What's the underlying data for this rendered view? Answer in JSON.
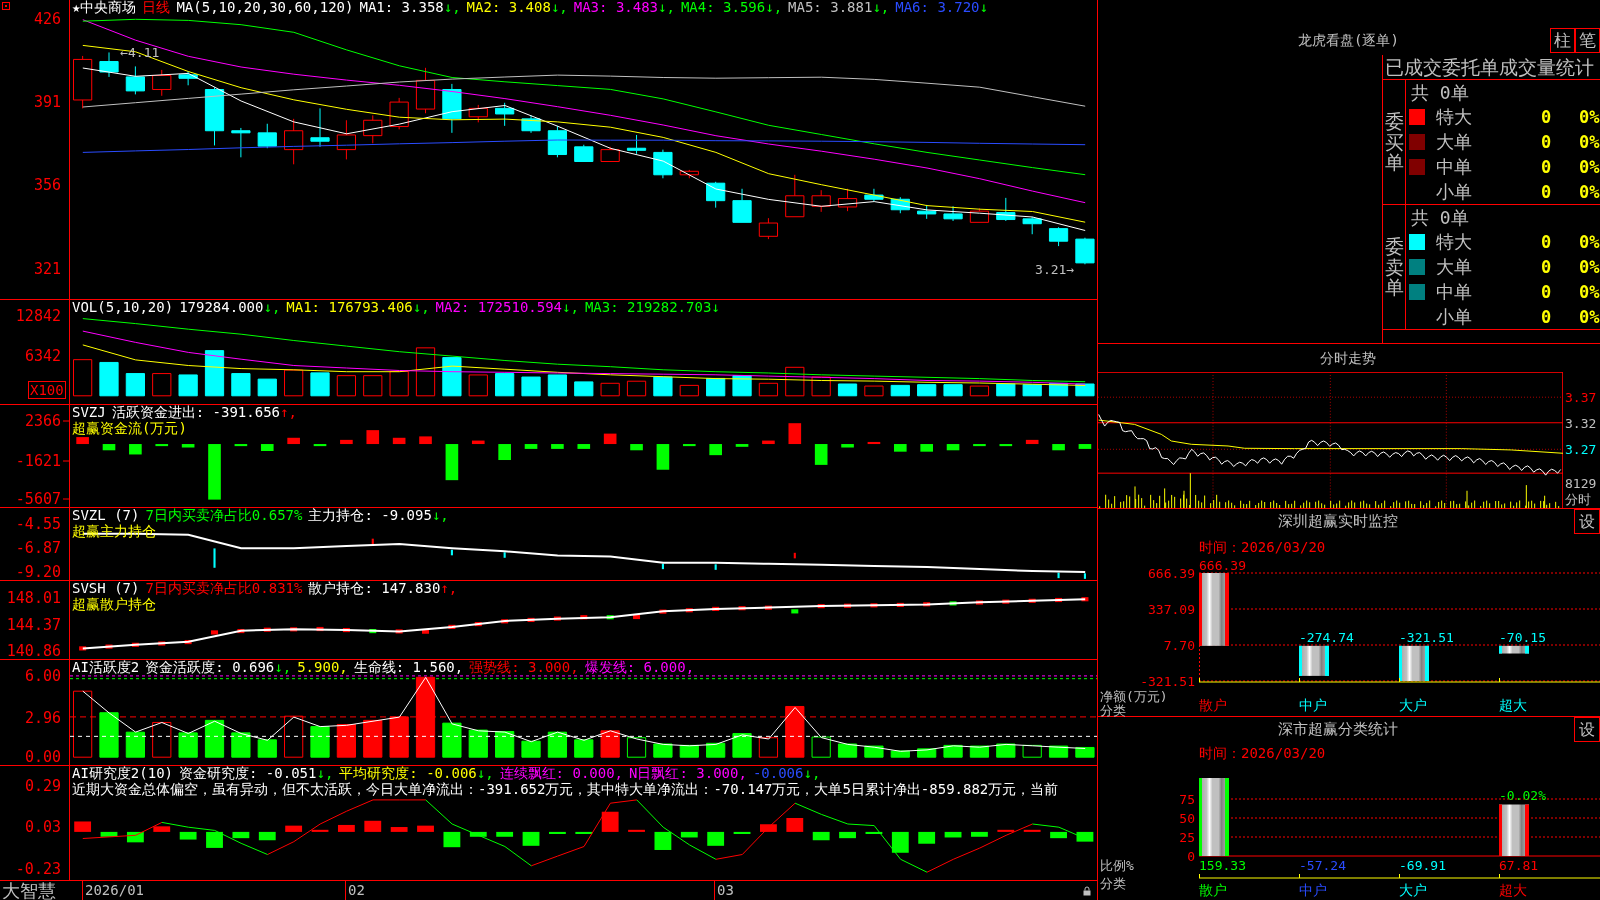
{
  "kline": {
    "header": [
      {
        "text": "★中央商场",
        "color": "#ffffff"
      },
      {
        "text": "日线",
        "color": "#ff0000"
      },
      {
        "text": "MA(5,10,20,30,60,120)",
        "color": "#ffffff"
      },
      {
        "text": "MA1: 3.358",
        "arrow": "↓,",
        "rising": false,
        "color": "#ffffff"
      },
      {
        "text": "MA2: 3.408",
        "arrow": "↓,",
        "rising": false,
        "color": "#ffff00"
      },
      {
        "text": "MA3: 3.483",
        "arrow": "↓,",
        "rising": false,
        "color": "#ff00ff"
      },
      {
        "text": "MA4: 3.596",
        "arrow": "↓,",
        "rising": false,
        "color": "#00ff00"
      },
      {
        "text": "MA5: 3.881",
        "arrow": "↓,",
        "rising": false,
        "color": "#c0c0c0"
      },
      {
        "text": "MA6: 3.720",
        "arrow": "↓",
        "rising": false,
        "color": "#2a4cff"
      }
    ],
    "chart_data": {
      "type": "line",
      "categories": [
        null,
        null,
        null,
        null,
        null,
        null,
        null,
        null,
        null,
        null,
        null,
        null,
        null,
        null,
        null,
        null,
        null,
        null,
        null,
        null
      ],
      "ylim": [
        308.2,
        434
      ],
      "yticks": [
        426,
        391,
        356,
        321
      ],
      "series": [
        {
          "color": "#ffffff",
          "values": [
            405.4,
            401.9,
            403.1,
            391.5,
            382.7,
            377.7,
            381.8,
            387.0,
            389.6,
            380.9,
            371.6,
            366.2,
            354.5,
            350.1,
            347.2,
            349.2,
            345.7,
            344.3,
            342.7,
            337.0
          ]
        },
        {
          "color": "#ffff00",
          "values": [
            414.9,
            412.2,
            403.9,
            397.1,
            392.0,
            388.0,
            384.7,
            383.6,
            383.9,
            382.7,
            380.5,
            376.2,
            369.9,
            360.9,
            356.3,
            351.9,
            347.5,
            346.0,
            345.0,
            340.5
          ]
        },
        {
          "color": "#ff00ff",
          "values": [
            425.7,
            417.1,
            410.3,
            405.8,
            402.8,
            400.3,
            398.1,
            395.5,
            392.5,
            389.1,
            385.5,
            381.4,
            376.9,
            373.4,
            370.4,
            367.0,
            363.3,
            358.8,
            353.6,
            348.7
          ]
        },
        {
          "color": "#00ff00",
          "values": [
            425.1,
            425.9,
            425.4,
            423.6,
            420.4,
            413.0,
            406.3,
            401.4,
            399.6,
            398.0,
            396.4,
            392.4,
            386.9,
            381.3,
            377.4,
            373.5,
            369.9,
            366.7,
            363.5,
            360.5
          ]
        },
        {
          "color": "#c0c0c0",
          "values": [
            389.0,
            390.8,
            392.6,
            394.4,
            396.2,
            397.8,
            399.5,
            400.7,
            401.6,
            402.4,
            402.0,
            401.4,
            401.1,
            401.3,
            401.5,
            400.6,
            399.0,
            397.3,
            393.3,
            389.3
          ]
        },
        {
          "color": "#2a4cff",
          "values": [
            369.9,
            370.5,
            371.1,
            371.8,
            372.4,
            372.9,
            373.5,
            374.0,
            374.6,
            375.1,
            375.0,
            375.0,
            374.8,
            374.7,
            374.6,
            374.4,
            374.1,
            373.7,
            373.4,
            373.1
          ]
        }
      ],
      "annotations": [
        "←4.11",
        "3.21→"
      ]
    }
  },
  "indicators": [
    {
      "kind": "volume",
      "header": [
        {
          "text": "VOL(5,10,20)",
          "color": "#ffffff"
        },
        {
          "text": "179284.000",
          "arrow": "↓,",
          "rising": false,
          "color": "#ffffff"
        },
        {
          "text": "MA1: 176793.406",
          "arrow": "↓,",
          "rising": false,
          "color": "#ffff00"
        },
        {
          "text": "MA2: 172510.594",
          "arrow": "↓,",
          "rising": false,
          "color": "#ff00ff"
        },
        {
          "text": "MA3: 219282.703",
          "arrow": "↓",
          "rising": false,
          "color": "#00ff00"
        }
      ],
      "chart_data": {
        "type": "line",
        "categories": [
          null,
          null,
          null,
          null,
          null,
          null,
          null,
          null,
          null,
          null,
          null,
          null,
          null,
          null,
          null,
          null,
          null,
          null,
          null,
          null
        ],
        "ylim": [
          -1265,
          15378
        ],
        "yticks": [
          12842,
          6342
        ],
        "series": [
          {
            "color": "#ffff00",
            "values": [
              8200,
              5800,
              4900,
              4400,
              4200,
              3900,
              3900,
              4800,
              4300,
              3800,
              3400,
              3100,
              2800,
              2700,
              2500,
              2400,
              2200,
              2100,
              1900,
              1700
            ]
          },
          {
            "color": "#ff00ff",
            "values": [
              10400,
              8600,
              7000,
              5900,
              4900,
              4500,
              4100,
              3900,
              3800,
              3700,
              3600,
              3500,
              3400,
              3200,
              3000,
              2800,
              2500,
              2400,
              2200,
              1900
            ]
          },
          {
            "color": "#00ff00",
            "values": [
              12400,
              11600,
              10700,
              9900,
              8900,
              8000,
              7100,
              6400,
              5700,
              5100,
              4700,
              4200,
              3900,
              3700,
              3400,
              3200,
              3000,
              2800,
              2500,
              2300
            ]
          }
        ]
      },
      "unit": "X100"
    },
    {
      "kind": "flow",
      "header": [
        {
          "text": "SVZJ",
          "color": "#ffffff"
        },
        {
          "text": "活跃资金进出: -391.656",
          "arrow": "↑,",
          "rising": true,
          "color": "#ffffff"
        }
      ],
      "subtitle": "超赢资金流(万元)",
      "axis_labels": [
        "2366",
        "-1621",
        "-5607"
      ]
    },
    {
      "kind": "main_holding",
      "header": [
        {
          "text": "SVZL (7)",
          "color": "#ffffff"
        },
        {
          "text": "7日内买卖净占比0.657%",
          "color": "#00ff00"
        },
        {
          "text": "主力持仓: -9.095",
          "arrow": "↓,",
          "rising": false,
          "color": "#ffffff"
        }
      ],
      "subtitle": "超赢主力持仓",
      "chart_data": {
        "type": "line",
        "categories": [
          null,
          null,
          null,
          null,
          null,
          null,
          null,
          null,
          null,
          null,
          null,
          null,
          null,
          null,
          null,
          null,
          null,
          null,
          null,
          null
        ],
        "ylim": [
          -9.959,
          -3.032
        ],
        "yticks": [
          {
            "value": -4.55,
            "label": "-4.55"
          },
          {
            "value": -6.87,
            "label": "-6.87"
          },
          {
            "value": -9.2,
            "label": "-9.20"
          }
        ],
        "series": [
          {
            "color": "#ffffff",
            "values": [
              -5.5,
              -5.5,
              -5.6,
              -6.9,
              -6.9,
              -6.7,
              -6.5,
              -6.9,
              -7.2,
              -7.6,
              -7.7,
              -8.3,
              -8.3,
              -8.4,
              -8.5,
              -8.6,
              -8.7,
              -8.9,
              -9.1,
              -9.2
            ]
          }
        ]
      }
    },
    {
      "kind": "retail_holding",
      "header": [
        {
          "text": "SVSH (7)",
          "color": "#ffffff"
        },
        {
          "text": "7日内买卖净占比0.831%",
          "color": "#ff0000"
        },
        {
          "text": "散户持仓: 147.830",
          "arrow": "↑,",
          "rising": true,
          "color": "#ffffff"
        }
      ],
      "subtitle": "超赢散户持仓",
      "chart_data": {
        "type": "line",
        "categories": [
          null,
          null,
          null,
          null,
          null,
          null,
          null,
          null,
          null,
          null,
          null,
          null,
          null,
          null,
          null,
          null,
          null,
          null,
          null,
          null
        ],
        "ylim": [
          139.8,
          150.26
        ],
        "yticks": [
          148.01,
          144.37,
          140.86
        ],
        "series": [
          {
            "color": "#ffffff",
            "values": [
              141.2,
              141.7,
              142.1,
              143.6,
              143.8,
              143.7,
              143.5,
              144.1,
              144.9,
              145.2,
              145.4,
              146.2,
              146.5,
              146.7,
              146.9,
              147.0,
              147.1,
              147.4,
              147.6,
              147.8
            ]
          }
        ]
      }
    },
    {
      "kind": "activity",
      "header": [
        {
          "text": "AI活跃度2",
          "color": "#ffffff"
        },
        {
          "text": "资金活跃度: 0.696",
          "arrow": "↓,",
          "rising": false,
          "color": "#ffffff"
        },
        {
          "text": "5.900,",
          "color": "#ffff00"
        },
        {
          "text": "生命线: 1.560,",
          "color": "#ffffff"
        },
        {
          "text": "强势线: 3.000,",
          "color": "#ff0000"
        },
        {
          "text": "爆发线: 6.000,",
          "color": "#ff00ff"
        }
      ],
      "chart_data": {
        "type": "line",
        "categories": [
          null,
          null,
          null,
          null,
          null,
          null,
          null,
          null,
          null,
          null,
          null,
          null,
          null,
          null,
          null,
          null,
          null,
          null,
          null,
          null,
          null,
          null,
          null,
          null,
          null,
          null,
          null,
          null,
          null,
          null,
          null,
          null,
          null,
          null,
          null,
          null,
          null,
          null,
          null
        ],
        "ylim": [
          -0.504,
          7.173
        ],
        "yticks": [
          {
            "value": 6,
            "label": "6.00"
          },
          {
            "value": 2.96,
            "label": "2.96"
          },
          {
            "value": 0,
            "label": "0.00"
          }
        ],
        "series": [
          {
            "color": "#ffffff",
            "values": [
              4.9,
              3.3,
              1.9,
              2.6,
              1.8,
              2.7,
              1.8,
              1.3,
              3.0,
              2.3,
              2.4,
              2.7,
              3.0,
              5.9,
              2.5,
              2.0,
              1.9,
              1.2,
              1.9,
              1.3,
              2.0,
              1.4,
              1.0,
              0.9,
              1.0,
              1.7,
              1.4,
              3.7,
              1.5,
              1.0,
              0.8,
              0.5,
              0.6,
              0.9,
              0.8,
              1.0,
              0.9,
              0.8,
              0.7
            ]
          }
        ]
      }
    },
    {
      "kind": "research",
      "header": [
        {
          "text": "AI研究度2(10)",
          "color": "#ffffff"
        },
        {
          "text": "资金研究度: -0.051",
          "arrow": "↓,",
          "rising": false,
          "color": "#ffffff"
        },
        {
          "text": "平均研究度: -0.006",
          "arrow": "↓,",
          "rising": false,
          "color": "#ffff00"
        },
        {
          "text": "连续飘红: 0.000,",
          "color": "#ff00ff"
        },
        {
          "text": "N日飘红: 3.000,",
          "color": "#ff00ff"
        },
        {
          "text": "-0.006",
          "arrow": "↓,",
          "rising": false,
          "color": "#2a4cff"
        }
      ],
      "note": "近期大资金总体偏空，虽有异动，但不太活跃，今日大单净流出：-391.652万元，其中特大单净流出：-70.147万元，大单5日累计净出-859.882万元，当前",
      "chart_data": {
        "type": "line",
        "categories": [
          null,
          null,
          null,
          null,
          null,
          null,
          null,
          null,
          null,
          null,
          null,
          null,
          null,
          null,
          null,
          null,
          null,
          null,
          null,
          null,
          null,
          null,
          null,
          null,
          null,
          null,
          null,
          null,
          null,
          null,
          null,
          null,
          null,
          null,
          null,
          null,
          null,
          null,
          null
        ],
        "ylim": [
          -0.2987,
          0.4115
        ],
        "yticks": [
          0.29,
          0.03,
          -0.23
        ],
        "series": [
          {
            "color": "#ff0000",
            "values": [
              -0.04,
              -0.03,
              -0.02,
              0.06,
              null,
              null,
              null,
              -0.14,
              -0.06,
              0.05,
              0.13,
              0.2,
              0.2,
              0.2,
              null,
              null,
              null,
              -0.21,
              -0.15,
              -0.09,
              0.18,
              0.2,
              null,
              null,
              -0.17,
              -0.14,
              0.03,
              0.18,
              null,
              null,
              null,
              null,
              -0.25,
              -0.17,
              -0.1,
              -0.02,
              0.05,
              null,
              null
            ]
          },
          {
            "color": "#00ff00",
            "values": [
              null,
              null,
              null,
              0.06,
              0.03,
              0.01,
              -0.07,
              -0.14,
              null,
              null,
              null,
              null,
              null,
              0.2,
              0.05,
              -0.02,
              -0.09,
              -0.21,
              null,
              null,
              null,
              0.2,
              0.03,
              -0.08,
              -0.17,
              null,
              null,
              0.18,
              0.11,
              0.05,
              0.04,
              -0.17,
              -0.25,
              null,
              null,
              null,
              0.05,
              0.03,
              -0.04
            ]
          }
        ]
      }
    }
  ],
  "time_axis": {
    "brand": "大智慧",
    "dates": [
      "2026/01",
      "02",
      "03"
    ]
  },
  "dragon_tiger": {
    "title": "龙虎看盘(逐单)",
    "buttons": [
      "柱",
      "笔"
    ],
    "table": {
      "title": "已成交委托单成交量统计",
      "groups": [
        {
          "label": "委买单",
          "total": "共 0单",
          "rows": [
            {
              "name": "特大",
              "count": "0",
              "percent": "0%",
              "color": "#ff0000"
            },
            {
              "name": "大单",
              "count": "0",
              "percent": "0%",
              "color": "#800000"
            },
            {
              "name": "中单",
              "count": "0",
              "percent": "0%",
              "color": "#800000"
            },
            {
              "name": "小单",
              "count": "0",
              "percent": "0%"
            }
          ]
        },
        {
          "label": "委卖单",
          "total": "共 0单",
          "rows": [
            {
              "name": "特大",
              "count": "0",
              "percent": "0%",
              "color": "#00ffff"
            },
            {
              "name": "大单",
              "count": "0",
              "percent": "0%",
              "color": "#008080"
            },
            {
              "name": "中单",
              "count": "0",
              "percent": "0%",
              "color": "#008080"
            },
            {
              "name": "小单",
              "count": "0",
              "percent": "0%"
            }
          ]
        }
      ]
    }
  },
  "minute_chart": {
    "title": "分时走势",
    "price_labels": [
      {
        "text": "3.37",
        "color": "#ff0000"
      },
      {
        "text": "3.32",
        "color": "#c0c0c0"
      },
      {
        "text": "3.27",
        "color": "#00ffff"
      }
    ],
    "volume_label": "8129",
    "period_label": "分时"
  },
  "realtime_monitor": {
    "title": "深圳超赢实时监控",
    "settings": "设",
    "time": "时间：2026/03/20",
    "chart_data": {
      "type": "bar",
      "xlabel": "分类",
      "ylabel": "净额(万元)",
      "categories": [
        "散户",
        "中户",
        "大户",
        "超大"
      ],
      "series": [
        {
          "color": "#ff0000",
          "values": [
            666.39,
            null,
            null,
            null
          ]
        },
        {
          "color": "#00ffff",
          "values": [
            null,
            -274.74,
            null,
            null
          ]
        },
        {
          "color": "#00ffff",
          "values": [
            null,
            null,
            -321.51,
            null
          ]
        },
        {
          "color": "#00ffff",
          "values": [
            null,
            null,
            null,
            -70.15
          ]
        }
      ],
      "stacked": true,
      "ylim": [
        -321.51,
        666.39
      ],
      "yticks": [
        {
          "value": 666.39,
          "label": "666.39"
        },
        {
          "value": 337.09,
          "label": "337.09"
        },
        {
          "value": 7.7,
          "label": "7.70"
        },
        {
          "value": -321.51,
          "label": "-321.51"
        }
      ],
      "grid": true,
      "data_labels": true
    }
  },
  "category_stats": {
    "title": "深市超赢分类统计",
    "settings": "设",
    "time": "时间：2026/03/20",
    "axis_labels": [
      "75",
      "50",
      "25",
      "0"
    ],
    "annotation": "-0.02%",
    "ylabel": "比例%",
    "xlabel": "分类",
    "categories": [
      {
        "name": "散户",
        "value": "159.33",
        "color": "#00ff00"
      },
      {
        "name": "中户",
        "value": "-57.24",
        "color": "#2a4cff"
      },
      {
        "name": "大户",
        "value": "-69.91",
        "color": "#00ffff"
      },
      {
        "name": "超大",
        "value": "67.81",
        "color": "#ff0000"
      }
    ]
  }
}
